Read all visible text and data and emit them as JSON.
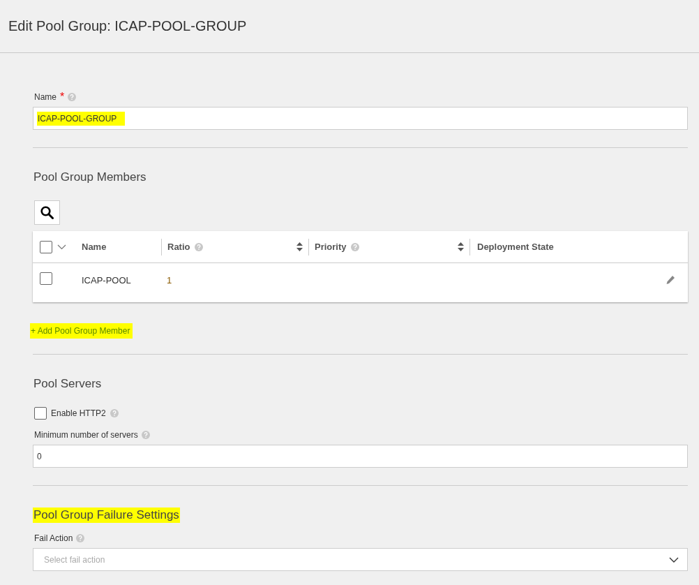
{
  "page": {
    "title": "Edit Pool Group: ICAP-POOL-GROUP"
  },
  "name_field": {
    "label": "Name",
    "required_mark": "*",
    "value": "ICAP-POOL-GROUP",
    "highlighted": true
  },
  "members": {
    "heading": "Pool Group Members",
    "highlighted": false,
    "columns": [
      {
        "label": "Name",
        "kind": "plain"
      },
      {
        "label": "Ratio",
        "kind": "sortable"
      },
      {
        "label": "Priority",
        "kind": "sortable"
      },
      {
        "label": "Deployment State",
        "kind": "plain"
      }
    ],
    "select_all_checked": false,
    "rows": [
      {
        "checked": false,
        "name": "ICAP-POOL",
        "ratio": "1"
      }
    ],
    "add_link": {
      "label": "+ Add Pool Group Member",
      "highlighted": true
    }
  },
  "servers": {
    "heading": "Pool Servers",
    "highlighted": false,
    "enable_http2": {
      "label": "Enable HTTP2",
      "checked": false
    },
    "min_servers": {
      "label": "Minimum number of servers",
      "value": "0"
    }
  },
  "failure": {
    "heading": "Pool Group Failure Settings",
    "highlighted": true,
    "fail_action": {
      "label": "Fail Action",
      "placeholder": "Select fail action"
    }
  }
}
